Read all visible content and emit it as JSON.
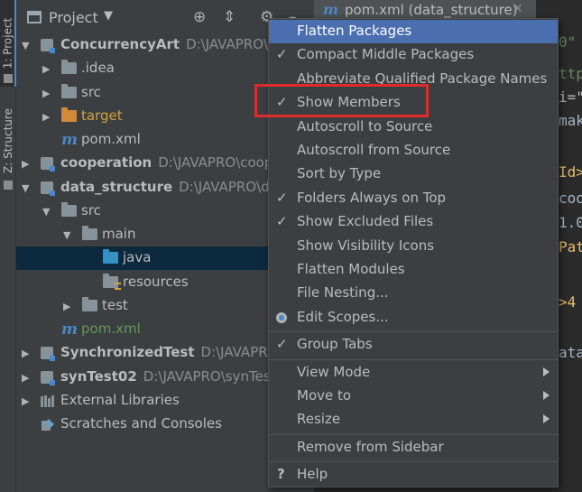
{
  "side_strip": {
    "project_tab": "1: Project",
    "structure_tab": "Z: Structure"
  },
  "project_panel": {
    "title": "Project",
    "header_icons": [
      "target-icon",
      "collapse-icon",
      "gear-icon",
      "minimize-icon"
    ],
    "tree": [
      {
        "label": "ConcurrencyArt",
        "path": "D:\\JAVAPRO\\C",
        "style": "bold",
        "icon": "module-icon",
        "expanded": true,
        "depth": 0
      },
      {
        "label": ".idea",
        "path": "",
        "style": "normal",
        "icon": "folder-icon",
        "expanded": false,
        "depth": 1
      },
      {
        "label": "src",
        "path": "",
        "style": "normal",
        "icon": "folder-icon",
        "expanded": false,
        "depth": 1
      },
      {
        "label": "target",
        "path": "",
        "style": "orange",
        "icon": "folder-excluded-icon",
        "expanded": false,
        "depth": 1
      },
      {
        "label": "pom.xml",
        "path": "",
        "style": "normal",
        "icon": "maven-icon",
        "expanded": null,
        "depth": 1
      },
      {
        "label": "cooperation",
        "path": "D:\\JAVAPRO\\coop",
        "style": "bold",
        "icon": "module-icon",
        "expanded": false,
        "depth": 0
      },
      {
        "label": "data_structure",
        "path": "D:\\JAVAPRO\\da",
        "style": "bold",
        "icon": "module-icon",
        "expanded": true,
        "depth": 0
      },
      {
        "label": "src",
        "path": "",
        "style": "normal",
        "icon": "folder-icon",
        "expanded": true,
        "depth": 1
      },
      {
        "label": "main",
        "path": "",
        "style": "normal",
        "icon": "folder-icon",
        "expanded": true,
        "depth": 2
      },
      {
        "label": "java",
        "path": "",
        "style": "normal",
        "icon": "source-folder-icon",
        "expanded": null,
        "depth": 3,
        "selected": true
      },
      {
        "label": "resources",
        "path": "",
        "style": "normal",
        "icon": "resources-folder-icon",
        "expanded": null,
        "depth": 3
      },
      {
        "label": "test",
        "path": "",
        "style": "normal",
        "icon": "folder-icon",
        "expanded": false,
        "depth": 2
      },
      {
        "label": "pom.xml",
        "path": "",
        "style": "green",
        "icon": "maven-icon",
        "expanded": null,
        "depth": 1
      },
      {
        "label": "SynchronizedTest",
        "path": "D:\\JAVAPRO",
        "style": "bold",
        "icon": "module-icon",
        "expanded": false,
        "depth": 0
      },
      {
        "label": "synTest02",
        "path": "D:\\JAVAPRO\\synTest",
        "style": "bold",
        "icon": "module-icon",
        "expanded": false,
        "depth": 0
      },
      {
        "label": "External Libraries",
        "path": "",
        "style": "normal",
        "icon": "libraries-icon",
        "expanded": false,
        "depth": 0
      },
      {
        "label": "Scratches and Consoles",
        "path": "",
        "style": "normal",
        "icon": "scratches-icon",
        "expanded": null,
        "depth": 0
      }
    ]
  },
  "editor": {
    "tab_label": "pom.xml (data_structure)",
    "code_fragments": [
      {
        "text": "0\"",
        "color": "#6a8759"
      },
      {
        "text": "ttp",
        "color": "#6a8759"
      },
      {
        "text": "i=\"",
        "color": "#bababa"
      },
      {
        "text": "mak",
        "color": "#a9b7c6"
      },
      {
        "text": "Id>",
        "color": "#e8bf6a"
      },
      {
        "text": "coo",
        "color": "#a9b7c6"
      },
      {
        "text": "1.0",
        "color": "#a9b7c6"
      },
      {
        "text": "Pat",
        "color": "#e8bf6a"
      },
      {
        "text": ">4",
        "color": "#e8bf6a"
      },
      {
        "text": "ata",
        "color": "#a9b7c6"
      }
    ]
  },
  "menu": {
    "groups": [
      [
        {
          "label": "Flatten Packages",
          "checked": false,
          "highlighted": true
        },
        {
          "label": "Compact Middle Packages",
          "checked": true
        },
        {
          "label": "Abbreviate Qualified Package Names",
          "checked": false
        },
        {
          "label": "Show Members",
          "checked": true,
          "annotated": true
        },
        {
          "label": "Autoscroll to Source",
          "checked": false
        },
        {
          "label": "Autoscroll from Source",
          "checked": false
        },
        {
          "label": "Sort by Type",
          "checked": false
        },
        {
          "label": "Folders Always on Top",
          "checked": true
        },
        {
          "label": "Show Excluded Files",
          "checked": true
        },
        {
          "label": "Show Visibility Icons",
          "checked": false
        },
        {
          "label": "Flatten Modules",
          "checked": false
        },
        {
          "label": "File Nesting...",
          "checked": false
        },
        {
          "label": "Edit Scopes...",
          "checked": false,
          "icon": "scopes-icon"
        }
      ],
      [
        {
          "label": "Group Tabs",
          "checked": true
        }
      ],
      [
        {
          "label": "View Mode",
          "submenu": true
        },
        {
          "label": "Move to",
          "submenu": true
        },
        {
          "label": "Resize",
          "submenu": true
        }
      ],
      [
        {
          "label": "Remove from Sidebar"
        }
      ],
      [
        {
          "label": "Help",
          "icon": "help-icon"
        }
      ]
    ]
  },
  "annotation": {
    "color": "#e02b2b",
    "target": "Show Members"
  }
}
